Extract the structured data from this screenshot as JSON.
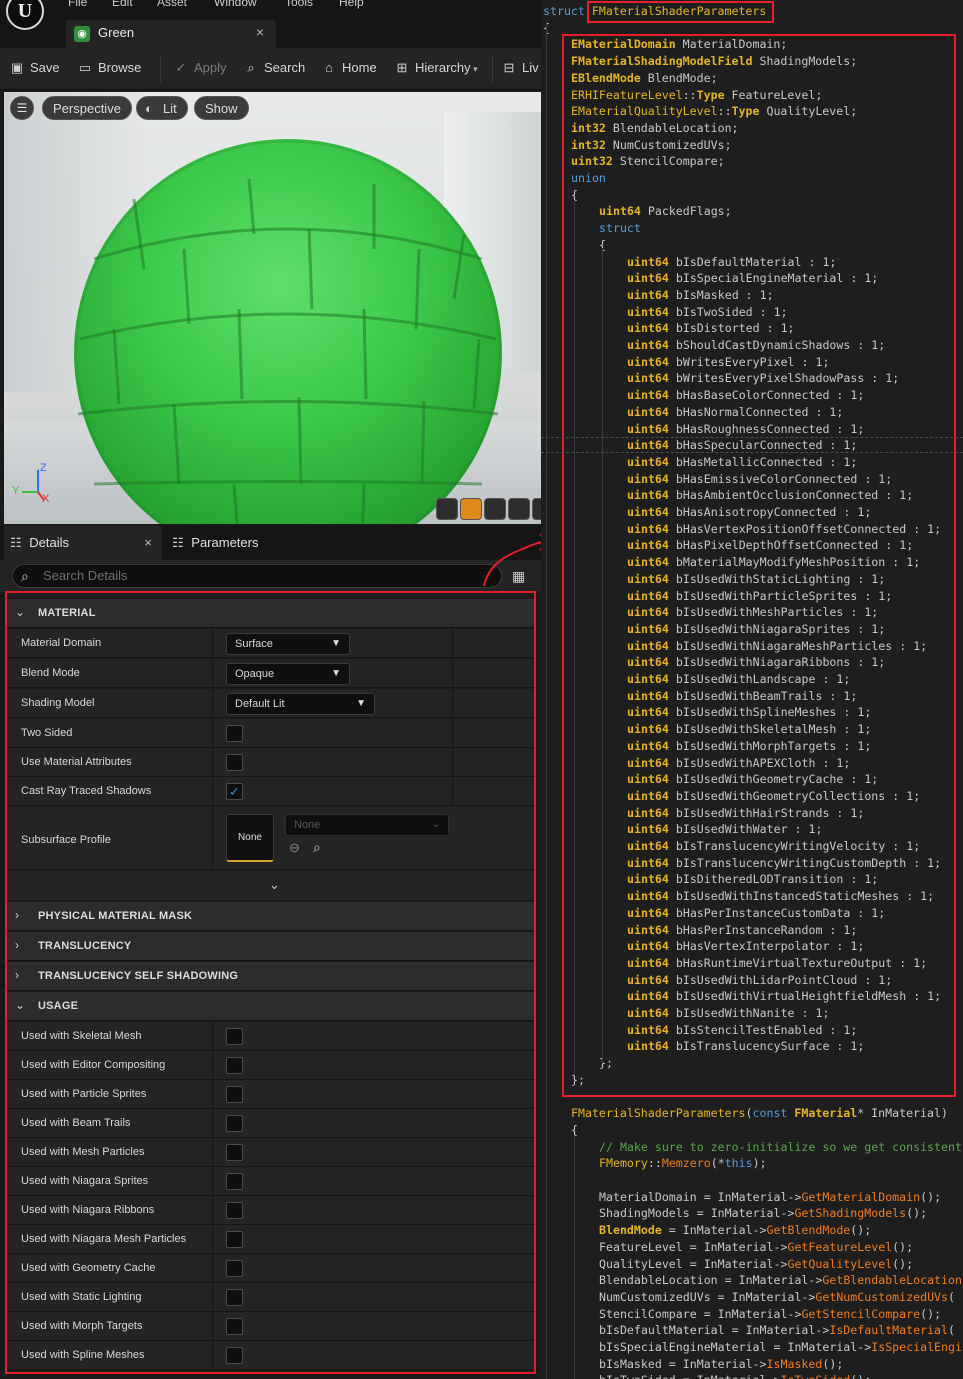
{
  "menu": [
    "File",
    "Edit",
    "Asset",
    "Window",
    "Tools",
    "Help"
  ],
  "asset_tab": {
    "title": "Green",
    "close": "×"
  },
  "toolbar": {
    "save": "Save",
    "browse": "Browse",
    "apply": "Apply",
    "search": "Search",
    "home": "Home",
    "hierarchy": "Hierarchy",
    "live": "Liv"
  },
  "viewport": {
    "perspective": "Perspective",
    "lit": "Lit",
    "show": "Show",
    "axis_z": "Z",
    "axis_y": "Y",
    "axis_x": "X"
  },
  "details": {
    "tab_details": "Details",
    "tab_close": "×",
    "tab_parameters": "Parameters",
    "search_placeholder": "Search Details",
    "categories": {
      "material": "MATERIAL",
      "physical": "PHYSICAL MATERIAL MASK",
      "translucency": "TRANSLUCENCY",
      "self_shadowing": "TRANSLUCENCY SELF SHADOWING",
      "usage": "USAGE"
    },
    "material_props": {
      "material_domain": {
        "label": "Material Domain",
        "value": "Surface"
      },
      "blend_mode": {
        "label": "Blend Mode",
        "value": "Opaque"
      },
      "shading_model": {
        "label": "Shading Model",
        "value": "Default Lit"
      },
      "two_sided": {
        "label": "Two Sided",
        "checked": false
      },
      "use_material_attributes": {
        "label": "Use Material Attributes",
        "checked": false
      },
      "cast_ray_traced_shadows": {
        "label": "Cast Ray Traced Shadows",
        "checked": true
      },
      "subsurface_profile": {
        "label": "Subsurface Profile",
        "thumb": "None",
        "value": "None"
      }
    },
    "usage": [
      "Used with Skeletal Mesh",
      "Used with Editor Compositing",
      "Used with Particle Sprites",
      "Used with Beam Trails",
      "Used with Mesh Particles",
      "Used with Niagara Sprites",
      "Used with Niagara Ribbons",
      "Used with Niagara Mesh Particles",
      "Used with Geometry Cache",
      "Used with Static Lighting",
      "Used with Morph Targets",
      "Used with Spline Meshes"
    ]
  },
  "code": {
    "struct_kw": "struct",
    "struct_name": "FMaterialShaderParameters",
    "open": "{",
    "fields": [
      [
        "EMaterialDomain",
        "MaterialDomain;"
      ],
      [
        "FMaterialShadingModelField",
        "ShadingModels;"
      ],
      [
        "EBlendMode",
        "BlendMode;"
      ],
      [
        "ERHIFeatureLevel::Type",
        "FeatureLevel;"
      ],
      [
        "EMaterialQualityLevel::Type",
        "QualityLevel;"
      ],
      [
        "int32",
        "BlendableLocation;"
      ],
      [
        "int32",
        "NumCustomizedUVs;"
      ],
      [
        "uint32",
        "StencilCompare;"
      ]
    ],
    "union_kw": "union",
    "packed": "PackedFlags;",
    "uint64": "uint64",
    "inner_struct": "struct",
    "bits": [
      "bIsDefaultMaterial",
      "bIsSpecialEngineMaterial",
      "bIsMasked",
      "bIsTwoSided",
      "bIsDistorted",
      "bShouldCastDynamicShadows",
      "bWritesEveryPixel",
      "bWritesEveryPixelShadowPass",
      "bHasBaseColorConnected",
      "bHasNormalConnected",
      "bHasRoughnessConnected",
      "bHasSpecularConnected",
      "bHasMetallicConnected",
      "bHasEmissiveColorConnected",
      "bHasAmbientOcclusionConnected",
      "bHasAnisotropyConnected",
      "bHasVertexPositionOffsetConnected",
      "bHasPixelDepthOffsetConnected",
      "bMaterialMayModifyMeshPosition",
      "bIsUsedWithStaticLighting",
      "bIsUsedWithParticleSprites",
      "bIsUsedWithMeshParticles",
      "bIsUsedWithNiagaraSprites",
      "bIsUsedWithNiagaraMeshParticles",
      "bIsUsedWithNiagaraRibbons",
      "bIsUsedWithLandscape",
      "bIsUsedWithBeamTrails",
      "bIsUsedWithSplineMeshes",
      "bIsUsedWithSkeletalMesh",
      "bIsUsedWithMorphTargets",
      "bIsUsedWithAPEXCloth",
      "bIsUsedWithGeometryCache",
      "bIsUsedWithGeometryCollections",
      "bIsUsedWithHairStrands",
      "bIsUsedWithWater",
      "bIsTranslucencyWritingVelocity",
      "bIsTranslucencyWritingCustomDepth",
      "bIsDitheredLODTransition",
      "bIsUsedWithInstancedStaticMeshes",
      "bHasPerInstanceCustomData",
      "bHasPerInstanceRandom",
      "bHasVertexInterpolator",
      "bHasRuntimeVirtualTextureOutput",
      "bIsUsedWithLidarPointCloud",
      "bIsUsedWithVirtualHeightfieldMesh",
      "bIsUsedWithNanite",
      "bIsStencilTestEnabled",
      "bIsTranslucencySurface"
    ],
    "bit_suffix": ": 1;",
    "close_inner": "};",
    "close_union": "};",
    "ctor_name": "FMaterialShaderParameters",
    "ctor_const": "const",
    "ctor_type": "FMaterial",
    "ctor_arg": "* InMaterial)",
    "ctor_open": "{",
    "comment": "// Make sure to zero-initialize so we get consistent",
    "memzero_ns": "FMemory",
    "memzero_fn": "Memzero",
    "memzero_args_a": "(*",
    "memzero_this": "this",
    "memzero_args_b": ");",
    "assigns": [
      [
        "MaterialDomain",
        "GetMaterialDomain",
        "();"
      ],
      [
        "ShadingModels",
        "GetShadingModels",
        "();"
      ],
      [
        "BlendMode",
        "GetBlendMode",
        "();"
      ],
      [
        "FeatureLevel",
        "GetFeatureLevel",
        "();"
      ],
      [
        "QualityLevel",
        "GetQualityLevel",
        "();"
      ],
      [
        "BlendableLocation",
        "GetBlendableLocation",
        ""
      ],
      [
        "NumCustomizedUVs",
        "GetNumCustomizedUVs",
        "("
      ],
      [
        "StencilCompare",
        "GetStencilCompare",
        "();"
      ],
      [
        "bIsDefaultMaterial",
        "IsDefaultMaterial",
        "("
      ],
      [
        "bIsSpecialEngineMaterial",
        "IsSpecialEngi",
        ""
      ],
      [
        "bIsMasked",
        "IsMasked",
        "();"
      ],
      [
        "bIsTwoSided",
        "IsTwoSided",
        "();"
      ]
    ],
    "arrow": "InMaterial->",
    "eq": " = "
  }
}
